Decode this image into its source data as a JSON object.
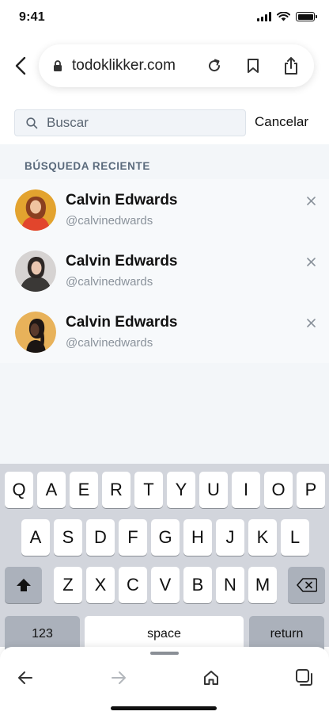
{
  "status": {
    "time": "9:41"
  },
  "browser": {
    "url": "todoklikker.com"
  },
  "search": {
    "placeholder": "Buscar",
    "value": "",
    "cancel_label": "Cancelar"
  },
  "recent": {
    "title": "BÚSQUEDA RECIENTE",
    "items": [
      {
        "name": "Calvin Edwards",
        "handle": "@calvinedwards",
        "avatar": "avatar-1"
      },
      {
        "name": "Calvin Edwards",
        "handle": "@calvinedwards",
        "avatar": "avatar-2"
      },
      {
        "name": "Calvin Edwards",
        "handle": "@calvinedwards",
        "avatar": "avatar-3"
      }
    ]
  },
  "keyboard": {
    "row1": [
      "Q",
      "A",
      "E",
      "R",
      "T",
      "Y",
      "U",
      "I",
      "O",
      "P"
    ],
    "row2": [
      "A",
      "S",
      "D",
      "F",
      "G",
      "H",
      "J",
      "K",
      "L"
    ],
    "row3": [
      "Z",
      "X",
      "C",
      "V",
      "B",
      "N",
      "M"
    ],
    "numbers_label": "123",
    "space_label": "space",
    "return_label": "return"
  },
  "icons": {
    "back": "chevron-left-icon",
    "lock": "lock-icon",
    "reload": "reload-icon",
    "bookmark": "bookmark-icon",
    "share": "share-icon",
    "search": "search-icon",
    "remove": "close-icon",
    "shift": "shift-icon",
    "delete": "backspace-icon",
    "nav_back": "arrow-left-icon",
    "nav_forward": "arrow-right-icon",
    "home": "home-icon",
    "tabs": "tabs-icon"
  },
  "colors": {
    "list_bg": "#f7f9fb",
    "section_title": "#5a6a7c",
    "keyboard_bg": "#d2d5dc"
  }
}
